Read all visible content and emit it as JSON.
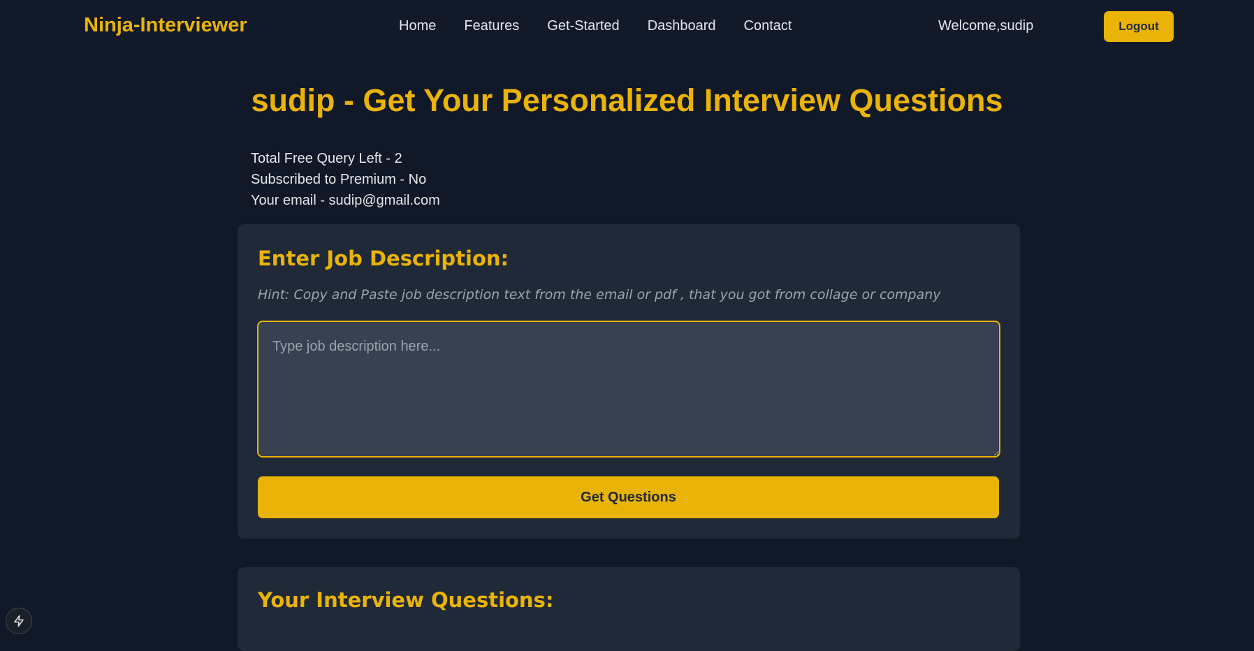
{
  "header": {
    "brand": "Ninja-Interviewer",
    "nav": [
      {
        "label": "Home"
      },
      {
        "label": "Features"
      },
      {
        "label": "Get-Started"
      },
      {
        "label": "Dashboard"
      },
      {
        "label": "Contact"
      }
    ],
    "welcome": "Welcome,sudip",
    "logout_label": "Logout"
  },
  "main": {
    "title": "sudip - Get Your Personalized Interview Questions",
    "info": {
      "queries_left": "Total Free Query Left - 2",
      "premium": "Subscribed to Premium - No",
      "email": "Your email - sudip@gmail.com"
    },
    "job_form": {
      "heading": "Enter Job Description:",
      "hint": "Hint: Copy and Paste job description text from the email or pdf , that you got from collage or company",
      "textarea_value": "",
      "textarea_placeholder": "Type job description here...",
      "submit_label": "Get Questions"
    },
    "questions": {
      "heading": "Your Interview Questions:"
    }
  },
  "floating": {
    "icon": "bolt-icon"
  },
  "colors": {
    "accent": "#eab308",
    "background": "#111827",
    "card": "#1f2937",
    "input": "#374151"
  }
}
